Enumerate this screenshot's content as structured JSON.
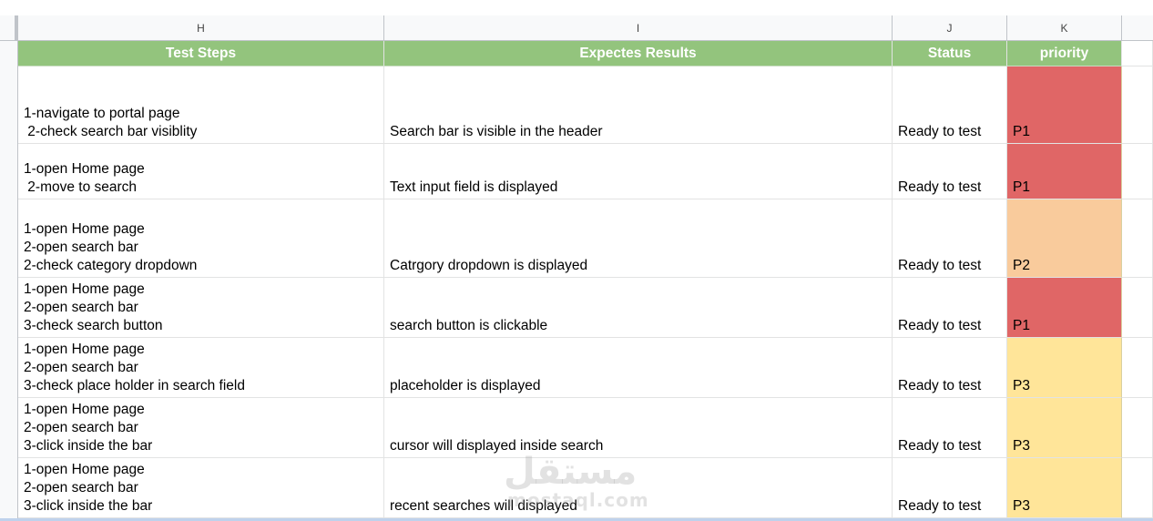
{
  "column_letters": [
    "H",
    "I",
    "J",
    "K"
  ],
  "header": {
    "steps": "Test Steps",
    "expected": "Expectes Results",
    "status": "Status",
    "priority": "priority"
  },
  "colors": {
    "header_green": "#93c47d",
    "P1": "#e06666",
    "P2": "#f9cb9c",
    "P3": "#ffe599"
  },
  "rows": [
    {
      "steps": "1-navigate to portal page\n 2-check search bar visiblity",
      "expected": "Search bar is visible in the header",
      "status": "Ready to test",
      "priority": "P1"
    },
    {
      "steps": "1-open Home page\n 2-move to search\n",
      "expected": "Text input field is displayed",
      "status": "Ready to test",
      "priority": "P1"
    },
    {
      "steps": "1-open Home page\n2-open search bar\n2-check category dropdown\n",
      "expected": "Catrgory dropdown is displayed",
      "status": "Ready to test",
      "priority": "P2"
    },
    {
      "steps": "1-open Home page\n2-open search bar\n3-check search button",
      "expected": "search button is clickable",
      "status": "Ready to test",
      "priority": "P1"
    },
    {
      "steps": "1-open Home page\n2-open search bar\n3-check place holder in search field",
      "expected": "placeholder is displayed",
      "status": "Ready to test",
      "priority": "P3"
    },
    {
      "steps": "1-open Home page\n2-open search bar\n3-click inside the bar",
      "expected": "cursor will displayed inside search",
      "status": "Ready to test",
      "priority": "P3"
    },
    {
      "steps": "1-open Home page\n2-open search bar\n3-click inside the bar",
      "expected": "recent searches will displayed",
      "status": "Ready to test",
      "priority": "P3"
    }
  ],
  "watermark": {
    "arabic": "مستقل",
    "latin": "mostaql.com"
  }
}
